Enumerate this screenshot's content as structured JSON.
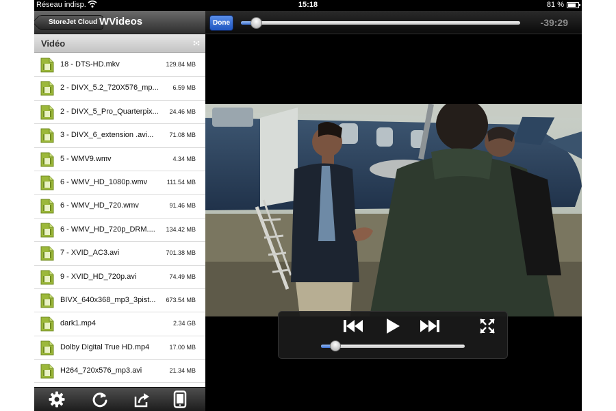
{
  "status_bar": {
    "carrier": "Réseau indisp.",
    "time": "15:18",
    "battery_percent": "81 %",
    "battery_level": 0.81
  },
  "nav": {
    "back_label": "StoreJet Cloud",
    "title": "WVideos"
  },
  "section": {
    "title": "Vidéo"
  },
  "files": [
    {
      "name": "18 - DTS-HD.mkv",
      "size": "129.84 MB"
    },
    {
      "name": "2 - DIVX_5.2_720X576_mp...",
      "size": "6.59 MB"
    },
    {
      "name": "2 - DIVX_5_Pro_Quarterpix...",
      "size": "24.46 MB"
    },
    {
      "name": "3 - DIVX_6_extension .avi...",
      "size": "71.08 MB"
    },
    {
      "name": "5 - WMV9.wmv",
      "size": "4.34 MB"
    },
    {
      "name": "6 - WMV_HD_1080p.wmv",
      "size": "111.54 MB"
    },
    {
      "name": "6 - WMV_HD_720.wmv",
      "size": "91.46 MB"
    },
    {
      "name": "6 - WMV_HD_720p_DRM....",
      "size": "134.42 MB"
    },
    {
      "name": "7 - XVID_AC3.avi",
      "size": "701.38 MB"
    },
    {
      "name": "9 - XVID_HD_720p.avi",
      "size": "74.49 MB"
    },
    {
      "name": "BIVX_640x368_mp3_3pist...",
      "size": "673.54 MB"
    },
    {
      "name": "dark1.mp4",
      "size": "2.34 GB"
    },
    {
      "name": "Dolby Digital True HD.mp4",
      "size": "17.00 MB"
    },
    {
      "name": "H264_720x576_mp3.avi",
      "size": "21.34 MB"
    }
  ],
  "toolbar": {
    "icons": [
      "gear-icon",
      "refresh-icon",
      "share-icon",
      "device-icon"
    ]
  },
  "player": {
    "done_label": "Done",
    "remaining_time": "-39:29",
    "scrub_position": 0.055,
    "volume_level": 0.1,
    "hud_icons": [
      "previous-icon",
      "play-icon",
      "next-icon",
      "fullscreen-icon"
    ]
  },
  "colors": {
    "accent_blue": "#2f63cf",
    "file_icon_green": "#9cb83a",
    "nav_dark": "#2e2e2e"
  }
}
